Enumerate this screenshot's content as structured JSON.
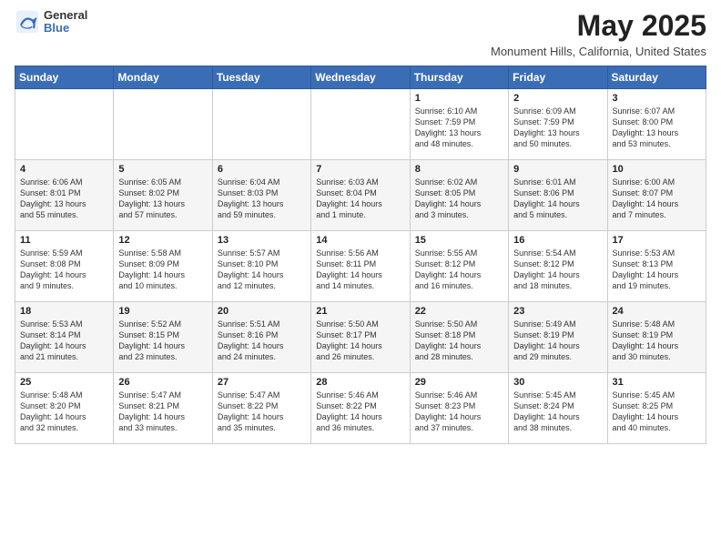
{
  "header": {
    "logo": {
      "general": "General",
      "blue": "Blue"
    },
    "title": "May 2025",
    "location": "Monument Hills, California, United States"
  },
  "days_of_week": [
    "Sunday",
    "Monday",
    "Tuesday",
    "Wednesday",
    "Thursday",
    "Friday",
    "Saturday"
  ],
  "weeks": [
    [
      {
        "day": "",
        "content": ""
      },
      {
        "day": "",
        "content": ""
      },
      {
        "day": "",
        "content": ""
      },
      {
        "day": "",
        "content": ""
      },
      {
        "day": "1",
        "content": "Sunrise: 6:10 AM\nSunset: 7:59 PM\nDaylight: 13 hours\nand 48 minutes."
      },
      {
        "day": "2",
        "content": "Sunrise: 6:09 AM\nSunset: 7:59 PM\nDaylight: 13 hours\nand 50 minutes."
      },
      {
        "day": "3",
        "content": "Sunrise: 6:07 AM\nSunset: 8:00 PM\nDaylight: 13 hours\nand 53 minutes."
      }
    ],
    [
      {
        "day": "4",
        "content": "Sunrise: 6:06 AM\nSunset: 8:01 PM\nDaylight: 13 hours\nand 55 minutes."
      },
      {
        "day": "5",
        "content": "Sunrise: 6:05 AM\nSunset: 8:02 PM\nDaylight: 13 hours\nand 57 minutes."
      },
      {
        "day": "6",
        "content": "Sunrise: 6:04 AM\nSunset: 8:03 PM\nDaylight: 13 hours\nand 59 minutes."
      },
      {
        "day": "7",
        "content": "Sunrise: 6:03 AM\nSunset: 8:04 PM\nDaylight: 14 hours\nand 1 minute."
      },
      {
        "day": "8",
        "content": "Sunrise: 6:02 AM\nSunset: 8:05 PM\nDaylight: 14 hours\nand 3 minutes."
      },
      {
        "day": "9",
        "content": "Sunrise: 6:01 AM\nSunset: 8:06 PM\nDaylight: 14 hours\nand 5 minutes."
      },
      {
        "day": "10",
        "content": "Sunrise: 6:00 AM\nSunset: 8:07 PM\nDaylight: 14 hours\nand 7 minutes."
      }
    ],
    [
      {
        "day": "11",
        "content": "Sunrise: 5:59 AM\nSunset: 8:08 PM\nDaylight: 14 hours\nand 9 minutes."
      },
      {
        "day": "12",
        "content": "Sunrise: 5:58 AM\nSunset: 8:09 PM\nDaylight: 14 hours\nand 10 minutes."
      },
      {
        "day": "13",
        "content": "Sunrise: 5:57 AM\nSunset: 8:10 PM\nDaylight: 14 hours\nand 12 minutes."
      },
      {
        "day": "14",
        "content": "Sunrise: 5:56 AM\nSunset: 8:11 PM\nDaylight: 14 hours\nand 14 minutes."
      },
      {
        "day": "15",
        "content": "Sunrise: 5:55 AM\nSunset: 8:12 PM\nDaylight: 14 hours\nand 16 minutes."
      },
      {
        "day": "16",
        "content": "Sunrise: 5:54 AM\nSunset: 8:12 PM\nDaylight: 14 hours\nand 18 minutes."
      },
      {
        "day": "17",
        "content": "Sunrise: 5:53 AM\nSunset: 8:13 PM\nDaylight: 14 hours\nand 19 minutes."
      }
    ],
    [
      {
        "day": "18",
        "content": "Sunrise: 5:53 AM\nSunset: 8:14 PM\nDaylight: 14 hours\nand 21 minutes."
      },
      {
        "day": "19",
        "content": "Sunrise: 5:52 AM\nSunset: 8:15 PM\nDaylight: 14 hours\nand 23 minutes."
      },
      {
        "day": "20",
        "content": "Sunrise: 5:51 AM\nSunset: 8:16 PM\nDaylight: 14 hours\nand 24 minutes."
      },
      {
        "day": "21",
        "content": "Sunrise: 5:50 AM\nSunset: 8:17 PM\nDaylight: 14 hours\nand 26 minutes."
      },
      {
        "day": "22",
        "content": "Sunrise: 5:50 AM\nSunset: 8:18 PM\nDaylight: 14 hours\nand 28 minutes."
      },
      {
        "day": "23",
        "content": "Sunrise: 5:49 AM\nSunset: 8:19 PM\nDaylight: 14 hours\nand 29 minutes."
      },
      {
        "day": "24",
        "content": "Sunrise: 5:48 AM\nSunset: 8:19 PM\nDaylight: 14 hours\nand 30 minutes."
      }
    ],
    [
      {
        "day": "25",
        "content": "Sunrise: 5:48 AM\nSunset: 8:20 PM\nDaylight: 14 hours\nand 32 minutes."
      },
      {
        "day": "26",
        "content": "Sunrise: 5:47 AM\nSunset: 8:21 PM\nDaylight: 14 hours\nand 33 minutes."
      },
      {
        "day": "27",
        "content": "Sunrise: 5:47 AM\nSunset: 8:22 PM\nDaylight: 14 hours\nand 35 minutes."
      },
      {
        "day": "28",
        "content": "Sunrise: 5:46 AM\nSunset: 8:22 PM\nDaylight: 14 hours\nand 36 minutes."
      },
      {
        "day": "29",
        "content": "Sunrise: 5:46 AM\nSunset: 8:23 PM\nDaylight: 14 hours\nand 37 minutes."
      },
      {
        "day": "30",
        "content": "Sunrise: 5:45 AM\nSunset: 8:24 PM\nDaylight: 14 hours\nand 38 minutes."
      },
      {
        "day": "31",
        "content": "Sunrise: 5:45 AM\nSunset: 8:25 PM\nDaylight: 14 hours\nand 40 minutes."
      }
    ]
  ]
}
